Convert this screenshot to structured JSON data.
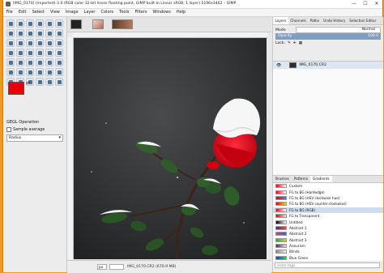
{
  "window": {
    "title": "[IMG_0170] (imported)-3.0 (RGB color 32-bit linear floating point, GIMP built-in Linear sRGB, 1 layer) 5196x3462 – GIMP",
    "controls": [
      "—",
      "☐",
      "✕"
    ]
  },
  "menu": [
    "File",
    "Edit",
    "Select",
    "View",
    "Image",
    "Layer",
    "Colors",
    "Tools",
    "Filters",
    "Windows",
    "Help"
  ],
  "toolbox": {
    "tool_icons": [
      "move-tool",
      "align-tool",
      "rect-select-tool",
      "ellipse-select-tool",
      "free-select-tool",
      "fuzzy-select-tool",
      "by-color-select-tool",
      "scissors-tool",
      "foreground-select-tool",
      "paths-tool",
      "color-picker-tool",
      "measure-tool",
      "zoom-tool",
      "crop-tool",
      "rotate-tool",
      "scale-tool",
      "shear-tool",
      "perspective-tool",
      "flip-tool",
      "cage-tool",
      "warp-tool",
      "text-tool",
      "bucket-fill-tool",
      "blend-tool",
      "pencil-tool",
      "paintbrush-tool",
      "eraser-tool",
      "airbrush-tool",
      "ink-tool",
      "mypaint-tool",
      "clone-tool",
      "heal-tool",
      "perspective-clone-tool",
      "blur-tool",
      "smudge-tool",
      "dodge-tool",
      "dodge-burn-tool",
      "unified-transform-tool",
      "handle-transform-tool",
      "gegl-tool",
      "seamless-clone-tool",
      "threshold-tool"
    ],
    "fg_color": "#e8000b",
    "bg_color": "#ffffff",
    "options_title": "GEGL Operation",
    "sample_merged": "Sample average",
    "radius_label": "Radius"
  },
  "image_tabs": [
    {
      "color": "#222"
    },
    {
      "color": "#d88a7a"
    },
    {
      "color": "#7a4d3a"
    }
  ],
  "statusbar": {
    "unit": "px",
    "zoom": "",
    "info": "IMG_0170.CR2 (670.9 MB)"
  },
  "dock": {
    "tabs": [
      "Layers",
      "Channels",
      "Paths",
      "Undo History",
      "Selection Editor"
    ],
    "mode_label": "Mode",
    "mode_value": "Normal",
    "opacity_label": "Opacity",
    "opacity_value": "100.0",
    "lock_label": "Lock:",
    "layer_name": "IMG_0170.CR2",
    "bottom_tabs": [
      "Brushes",
      "Patterns",
      "Gradients"
    ],
    "gradients": [
      {
        "name": "Custom",
        "c1": "#e8000b",
        "c2": "#ffffff"
      },
      {
        "name": "FG to BG (Hardedge)",
        "c1": "#e8000b",
        "c2": "#ffffff"
      },
      {
        "name": "FG to BG (HSV clockwise hue)",
        "c1": "#e8000b",
        "c2": "#4a7fe0"
      },
      {
        "name": "FG to BG (HSV counter-clockwise)",
        "c1": "#e8000b",
        "c2": "#e0d34a"
      },
      {
        "name": "FG to BG (RGB)",
        "c1": "#e8000b",
        "c2": "#ffffff"
      },
      {
        "name": "FG to Transparent",
        "c1": "#e8000b",
        "c2": "#dddddd"
      },
      {
        "name": "Untitled",
        "c1": "#000000",
        "c2": "#ffffff"
      },
      {
        "name": "Abstract 1",
        "c1": "#3b2a8c",
        "c2": "#e85a2a"
      },
      {
        "name": "Abstract 2",
        "c1": "#d83a7a",
        "c2": "#2a6ad8"
      },
      {
        "name": "Abstract 3",
        "c1": "#2aa85a",
        "c2": "#d8c82a"
      },
      {
        "name": "Aneurism",
        "c1": "#6a1a6a",
        "c2": "#e0e0e0"
      },
      {
        "name": "Blinds",
        "c1": "#888888",
        "c2": "#eeeeee"
      },
      {
        "name": "Blue Green",
        "c1": "#1a3ad8",
        "c2": "#1ad85a"
      }
    ],
    "filter_placeholder": "enter tags"
  }
}
